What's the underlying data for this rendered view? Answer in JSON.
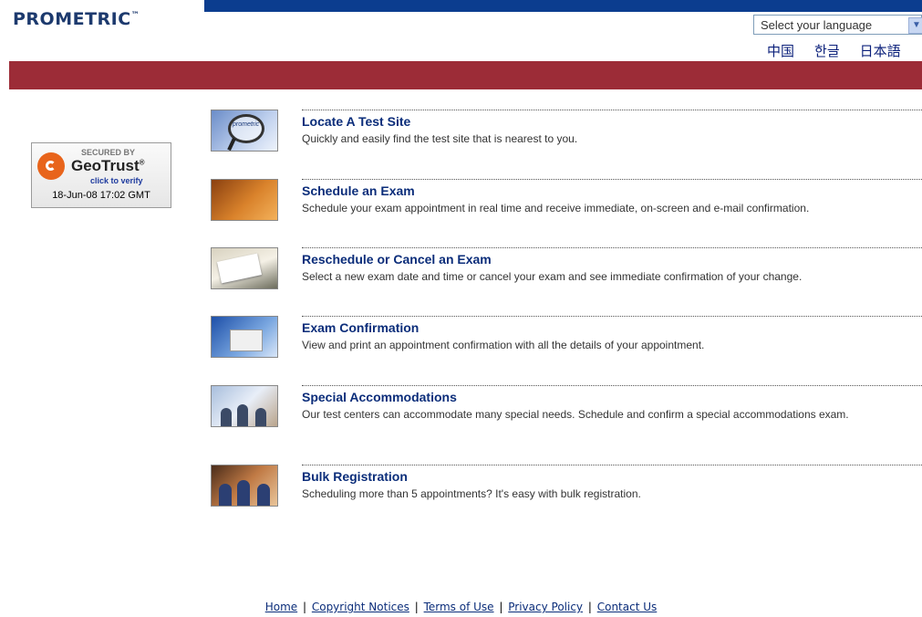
{
  "brand": {
    "name": "PROMETRIC",
    "trademark": "™"
  },
  "language": {
    "placeholder": "Select your language",
    "links": [
      "中国",
      "한글",
      "日本語"
    ]
  },
  "badge": {
    "secured_by": "SECURED BY",
    "name": "GeoTrust",
    "registered": "®",
    "verify": "click to verify",
    "timestamp": "18-Jun-08 17:02 GMT"
  },
  "items": [
    {
      "title": "Locate A Test Site",
      "desc": "Quickly and easily find the test site that is nearest to you."
    },
    {
      "title": "Schedule an Exam",
      "desc": "Schedule your exam appointment in real time and receive immediate, on-screen and e-mail confirmation."
    },
    {
      "title": "Reschedule or Cancel an Exam",
      "desc": "Select a new exam date and time or cancel your exam and see immediate confirmation of your change."
    },
    {
      "title": "Exam Confirmation",
      "desc": "View and print an appointment confirmation with all the details of your appointment."
    },
    {
      "title": "Special Accommodations",
      "desc": "Our test centers can accommodate many special needs. Schedule and confirm a special accommodations exam."
    },
    {
      "title": "Bulk Registration",
      "desc": "Scheduling more than 5 appointments? It's easy with bulk registration."
    }
  ],
  "thumbnail_text": {
    "locate": "prometric"
  },
  "footer": {
    "links": [
      "Home",
      "Copyright Notices",
      "Terms of Use",
      "Privacy Policy",
      "Contact Us"
    ],
    "separator": "|"
  },
  "colors": {
    "top_bar": "#0b3d8f",
    "red_bar": "#9c2c37",
    "link": "#0b2d7a",
    "logo": "#1d3a6e"
  }
}
